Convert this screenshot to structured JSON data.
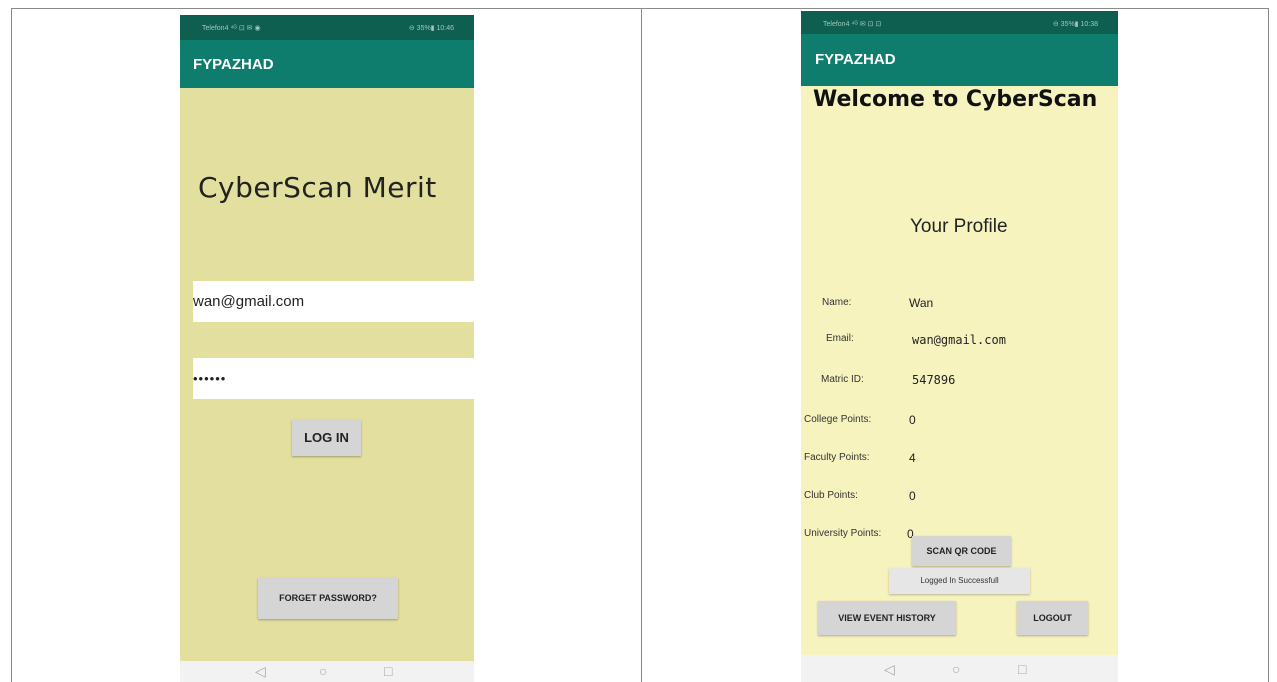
{
  "left_screen": {
    "status_left": "Telefon4 ⁴ᴳ ⊡ ✉ ◉",
    "status_right": "⊖ 35%▮ 10:46",
    "app_title": "FYPAZHAD",
    "brand_title": "CyberScan Merit",
    "email_value": "wan@gmail.com",
    "password_value": "••••••",
    "login_label": "LOG IN",
    "forgot_label": "FORGET PASSWORD?",
    "nav": {
      "back": "◁",
      "home": "○",
      "recents": "□"
    }
  },
  "right_screen": {
    "status_left": "Telefon4 ⁴ᴳ ✉ ⊡ ⊡",
    "status_right": "⊖ 35%▮ 10:38",
    "app_title": "FYPAZHAD",
    "welcome": "Welcome to CyberScan",
    "profile_heading": "Your Profile",
    "rows": [
      {
        "label": "Name:",
        "value": "Wan"
      },
      {
        "label": "Email:",
        "value": "wan@gmail.com"
      },
      {
        "label": "Matric ID:",
        "value": "547896"
      },
      {
        "label": "College Points:",
        "value": "0"
      },
      {
        "label": "Faculty Points:",
        "value": "4"
      },
      {
        "label": "Club Points:",
        "value": "0"
      },
      {
        "label": "University Points:",
        "value": "0"
      }
    ],
    "scan_label": "SCAN QR CODE",
    "toast": "Logged In Successfull",
    "history_label": "VIEW EVENT HISTORY",
    "logout_label": "LOGOUT",
    "nav": {
      "back": "◁",
      "home": "○",
      "recents": "□"
    }
  },
  "colors": {
    "status_bar": "#0e5f50",
    "app_bar": "#0f7d6d",
    "left_background": "#e3df9e",
    "right_background": "#f7f3bf",
    "button": "#d5d5d5"
  }
}
